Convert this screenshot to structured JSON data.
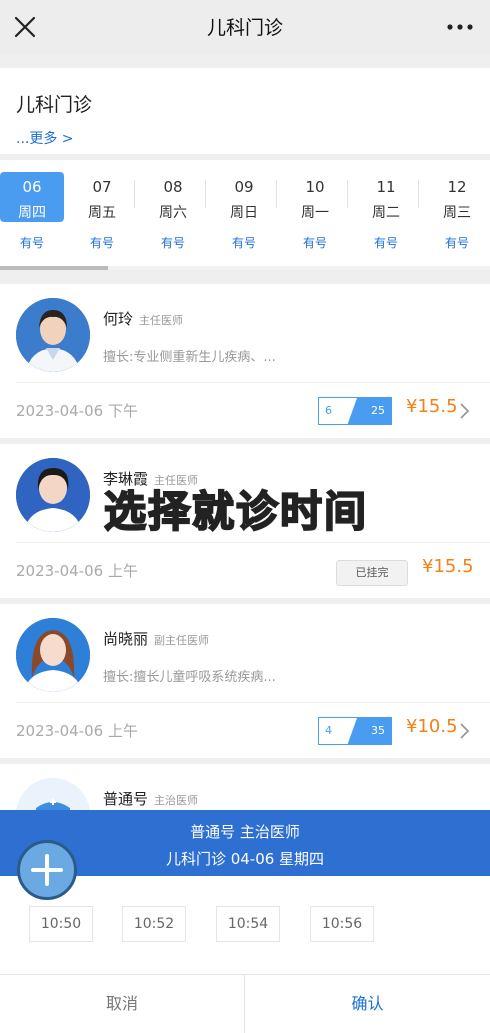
{
  "nav": {
    "title": "儿科门诊"
  },
  "dept": {
    "name": "儿科门诊",
    "more": "...更多 >"
  },
  "dates": [
    {
      "day": "06",
      "weekday": "周四",
      "status": "有号"
    },
    {
      "day": "07",
      "weekday": "周五",
      "status": "有号"
    },
    {
      "day": "08",
      "weekday": "周六",
      "status": "有号"
    },
    {
      "day": "09",
      "weekday": "周日",
      "status": "有号"
    },
    {
      "day": "10",
      "weekday": "周一",
      "status": "有号"
    },
    {
      "day": "11",
      "weekday": "周二",
      "status": "有号"
    },
    {
      "day": "12",
      "weekday": "周三",
      "status": "有号"
    }
  ],
  "doctors": [
    {
      "name": "何玲",
      "title": "主任医师",
      "specialty": "擅长:专业侧重新生儿疾病、...",
      "date": "2023-04-06 下午",
      "quota_left": "6",
      "quota_total": "25",
      "price": "¥15.5"
    },
    {
      "name": "李琳霞",
      "title": "主任医师",
      "specialty": "",
      "date": "2023-04-06 上午",
      "status": "已挂完",
      "price": "¥15.5"
    },
    {
      "name": "尚晓丽",
      "title": "副主任医师",
      "specialty": "擅长:擅长儿童呼吸系统疾病...",
      "date": "2023-04-06 上午",
      "quota_left": "4",
      "quota_total": "35",
      "price": "¥10.5"
    },
    {
      "name": "普通号",
      "title": "主治医师"
    }
  ],
  "overlay": {
    "caption": "选择就诊时间"
  },
  "sheet": {
    "line1": "普通号   主治医师",
    "line2": "儿科门诊   04-06   星期四",
    "slots": [
      "10:50",
      "10:52",
      "10:54",
      "10:56"
    ],
    "cancel": "取消",
    "confirm": "确认"
  },
  "colors": {
    "accent": "#1e6fd9",
    "active_date": "#4a9cf0",
    "price": "#f08219",
    "caption": "#ffe14a",
    "sheet_header": "#2e6fd2"
  },
  "icons": {
    "close": "close-icon",
    "more": "more-dots-icon",
    "arrow": "chevron-right-icon",
    "fab": "plus-icon"
  }
}
